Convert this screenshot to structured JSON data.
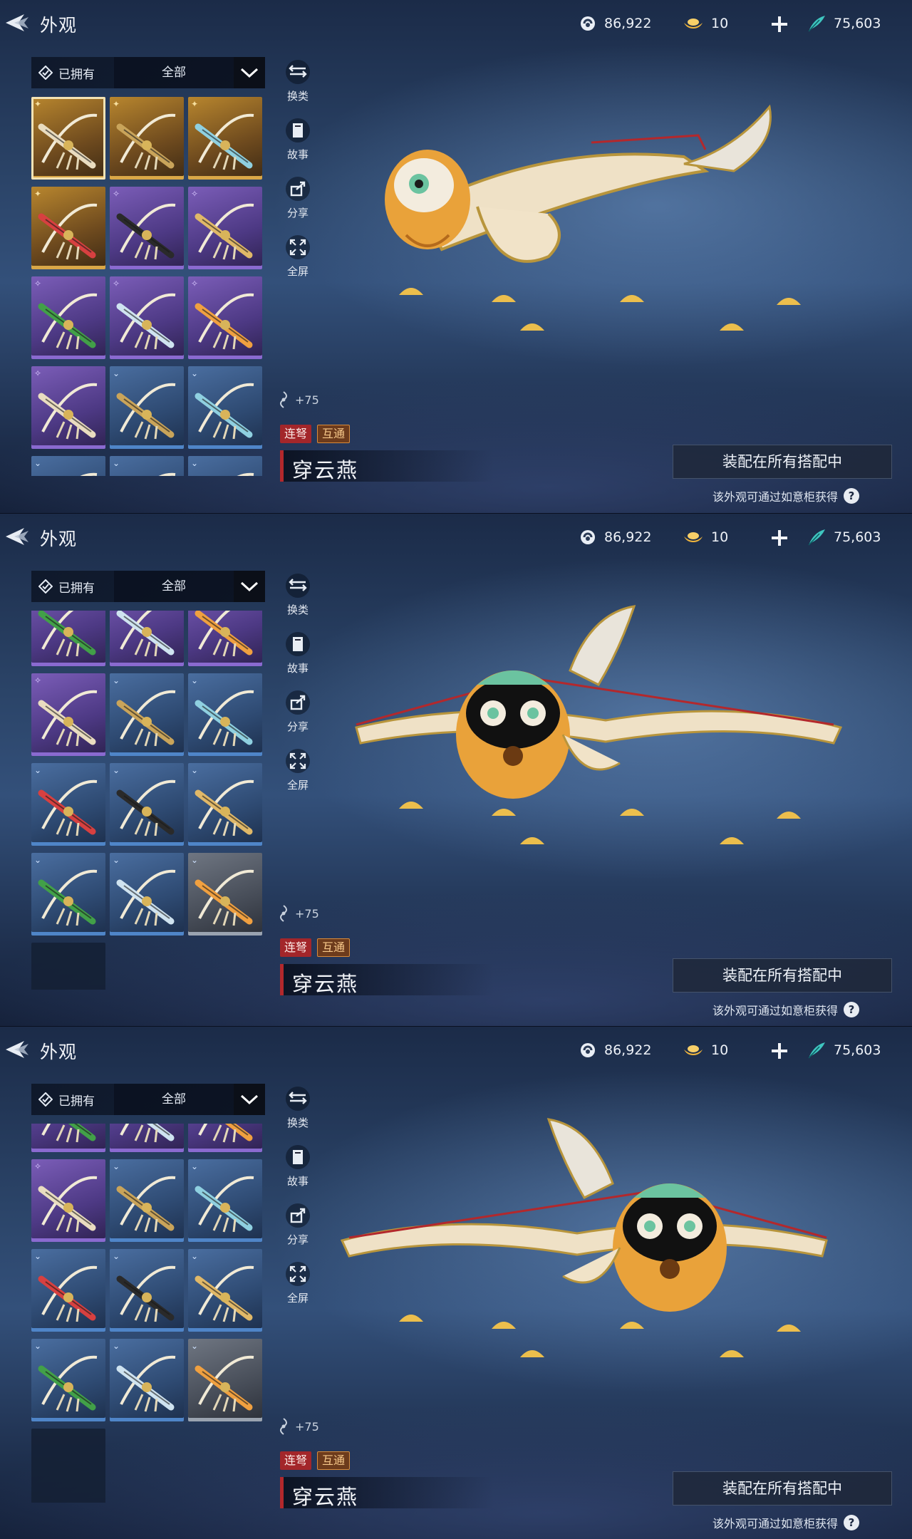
{
  "header": {
    "title": "外观",
    "jade": "86,922",
    "gold": "10",
    "feather": "75,603"
  },
  "filter": {
    "owned_label": "已拥有",
    "category_label": "全部"
  },
  "actions": [
    {
      "label": "换类",
      "icon": "swap-category-icon"
    },
    {
      "label": "故事",
      "icon": "story-book-icon"
    },
    {
      "label": "分享",
      "icon": "share-icon"
    },
    {
      "label": "全屏",
      "icon": "fullscreen-icon"
    }
  ],
  "item": {
    "power": "+75",
    "tags": [
      "连弩",
      "互通"
    ],
    "name": "穿云燕"
  },
  "equip_button": "装配在所有搭配中",
  "source_hint": "该外观可通过如意柜获得",
  "grid_items": [
    {
      "rarity": "gold",
      "selected": true
    },
    {
      "rarity": "gold"
    },
    {
      "rarity": "gold"
    },
    {
      "rarity": "gold"
    },
    {
      "rarity": "purple"
    },
    {
      "rarity": "purple"
    },
    {
      "rarity": "purple"
    },
    {
      "rarity": "purple"
    },
    {
      "rarity": "purple"
    },
    {
      "rarity": "purple"
    },
    {
      "rarity": "blue"
    },
    {
      "rarity": "blue"
    },
    {
      "rarity": "blue"
    },
    {
      "rarity": "blue"
    },
    {
      "rarity": "blue"
    },
    {
      "rarity": "blue"
    },
    {
      "rarity": "blue"
    },
    {
      "rarity": "grey"
    },
    {
      "rarity": "empty"
    }
  ],
  "colors": {
    "gold": "#d9a747",
    "purple": "#8a6ad0",
    "blue": "#4f85c8",
    "grey": "#9aa3b0",
    "tag_red": "#a3262a",
    "tag_orange": "#d98b3a"
  },
  "screens": [
    {
      "scroll_rows": 0
    },
    {
      "scroll_rows": 2.3
    },
    {
      "scroll_rows": 2.6
    }
  ]
}
